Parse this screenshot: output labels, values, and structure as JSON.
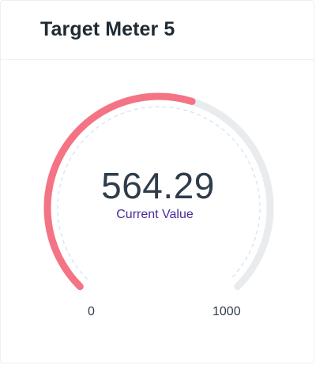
{
  "card": {
    "title": "Target Meter 5"
  },
  "gauge": {
    "value": 564.29,
    "value_label": "564.29",
    "caption": "Current Value",
    "min": 0,
    "min_label": "0",
    "max": 1000,
    "max_label": "1000",
    "colors": {
      "fill": "#f47385",
      "track": "#e8ecef",
      "target_ring": "#cfe3f2"
    }
  }
}
